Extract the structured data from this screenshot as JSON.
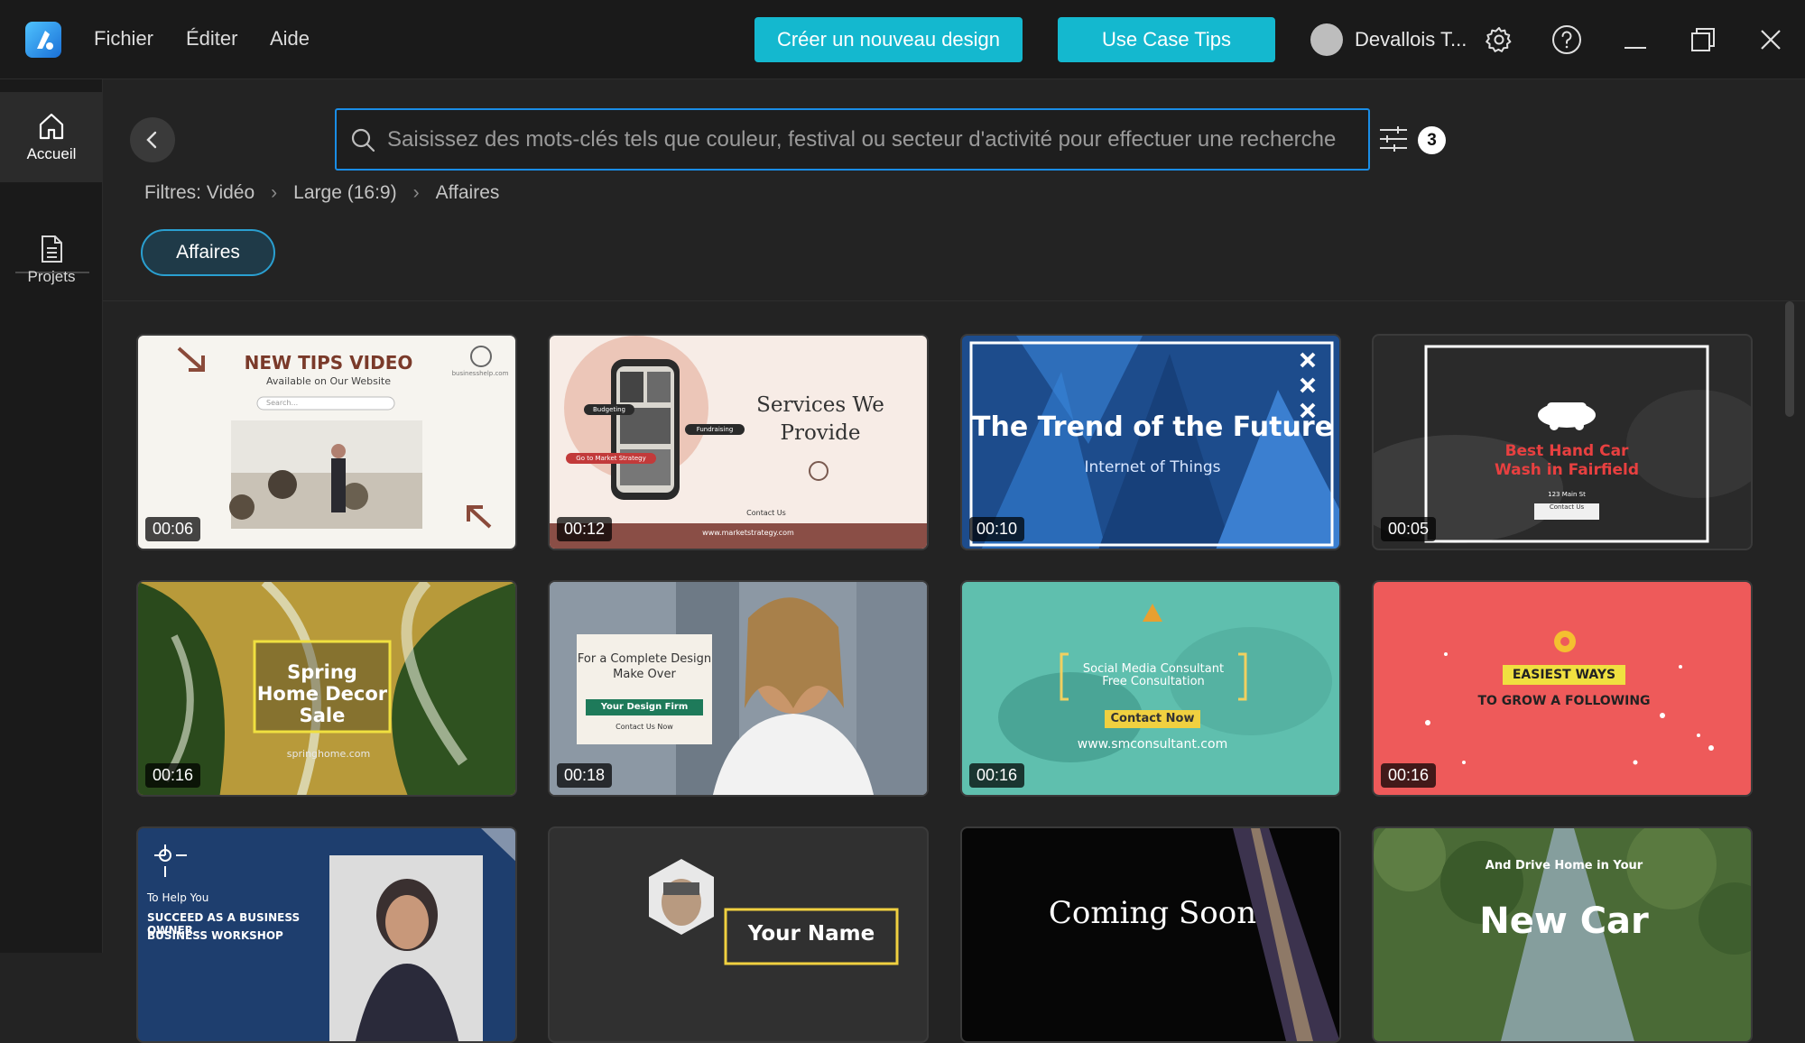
{
  "app": {
    "menu": [
      "Fichier",
      "Éditer",
      "Aide"
    ],
    "create_button": "Créer un nouveau design",
    "tips_button": "Use Case Tips",
    "username": "Devallois T..."
  },
  "sidebar": {
    "items": [
      {
        "label": "Accueil",
        "icon": "home-icon"
      },
      {
        "label": "Projets",
        "icon": "document-icon"
      }
    ]
  },
  "search": {
    "placeholder": "Saisissez des mots-clés tels que couleur, festival ou secteur d'activité pour effectuer une recherche",
    "filter_count": "3"
  },
  "breadcrumb": [
    "Filtres: Vidéo",
    "Large (16:9)",
    "Affaires"
  ],
  "chip": "Affaires",
  "templates": [
    {
      "duration": "00:06",
      "title": "NEW TIPS VIDEO",
      "subtitle": "Available on Our Website",
      "search_text": "Search...",
      "brand": "businesshelp.com"
    },
    {
      "duration": "00:12",
      "title": "Services We Provide",
      "tags": [
        "Budgeting",
        "Fundraising",
        "Go to Market Strategy"
      ],
      "contact": "Contact Us",
      "url": "www.marketstrategy.com"
    },
    {
      "duration": "00:10",
      "title": "The Trend of the Future",
      "subtitle": "Internet of Things"
    },
    {
      "duration": "00:05",
      "title": "Best Hand Car Wash in Fairfield",
      "address": "123 Main St",
      "contact": "Contact Us"
    },
    {
      "duration": "00:16",
      "title": "Spring Home Decor Sale",
      "url": "springhome.com"
    },
    {
      "duration": "00:18",
      "line1": "For a Complete Design Make Over",
      "firm": "Your Design Firm",
      "contact": "Contact Us Now"
    },
    {
      "duration": "00:16",
      "title": "Social Media Consultant Free Consultation",
      "cta": "Contact Now",
      "url": "www.smconsultant.com"
    },
    {
      "duration": "00:16",
      "title": "EASIEST WAYS",
      "subtitle": "TO GROW A FOLLOWING"
    },
    {
      "duration": "",
      "line1": "To Help You",
      "line2": "SUCCEED AS A BUSINESS OWNER",
      "line3": "BUSINESS WORKSHOP"
    },
    {
      "duration": "",
      "title": "Your Name"
    },
    {
      "duration": "",
      "title": "Coming Soon"
    },
    {
      "duration": "",
      "line1": "And Drive Home in Your",
      "title": "New Car"
    }
  ],
  "colors": {
    "accent": "#14b8cf",
    "search_border": "#1a8de6",
    "chip_border": "#2a9fd0"
  }
}
